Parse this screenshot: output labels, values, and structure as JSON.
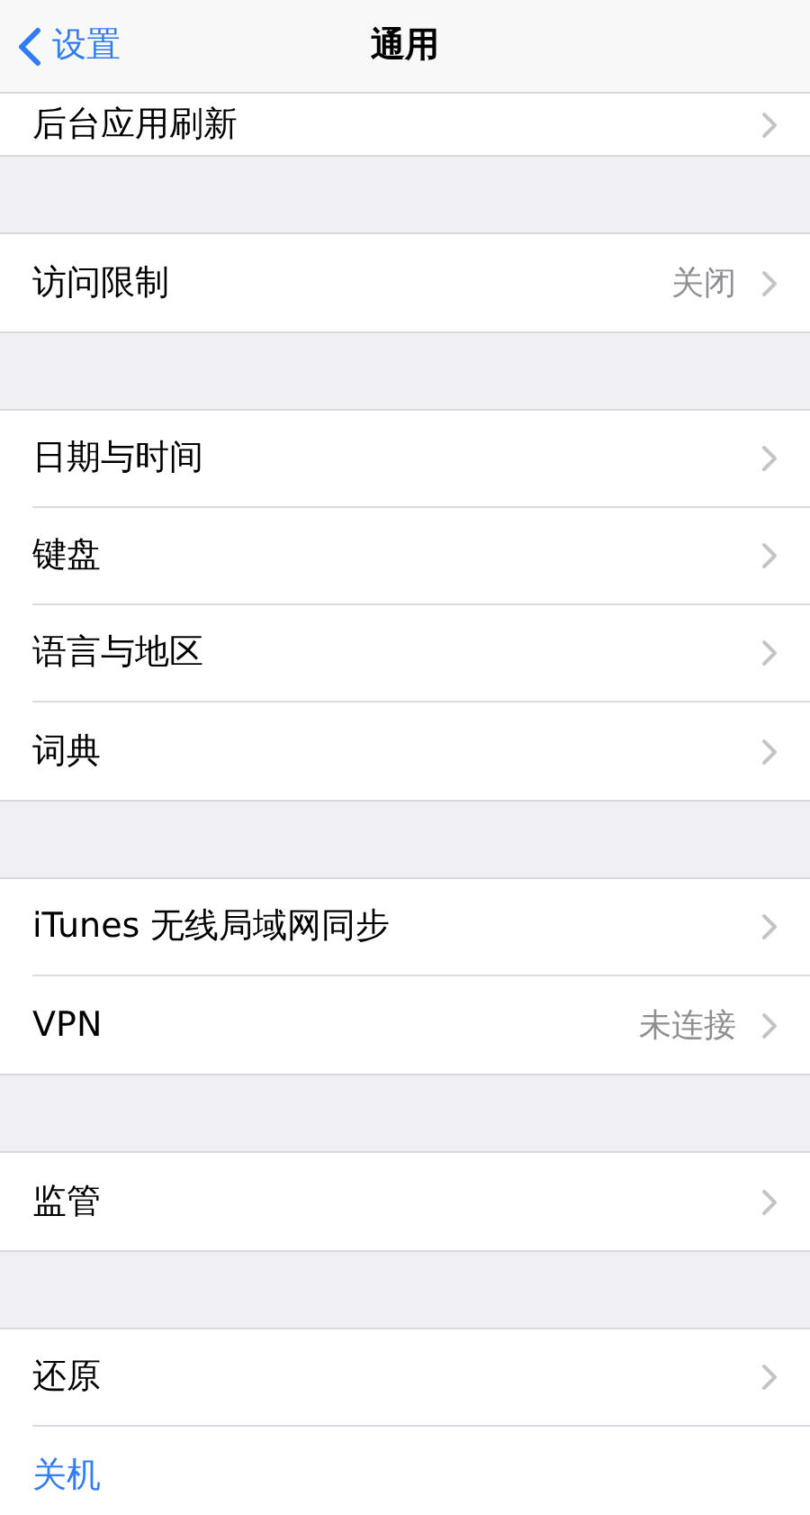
{
  "nav": {
    "back": "设置",
    "title": "通用"
  },
  "groups": [
    {
      "items": [
        {
          "kind": "link",
          "label": "后台应用刷新"
        }
      ]
    },
    {
      "items": [
        {
          "kind": "link",
          "label": "访问限制",
          "value": "关闭"
        }
      ]
    },
    {
      "items": [
        {
          "kind": "link",
          "label": "日期与时间"
        },
        {
          "kind": "link",
          "label": "键盘"
        },
        {
          "kind": "link",
          "label": "语言与地区"
        },
        {
          "kind": "link",
          "label": "词典"
        }
      ]
    },
    {
      "items": [
        {
          "kind": "link",
          "label": "iTunes 无线局域网同步"
        },
        {
          "kind": "link",
          "label": "VPN",
          "value": "未连接"
        }
      ]
    },
    {
      "items": [
        {
          "kind": "link",
          "label": "监管"
        }
      ]
    },
    {
      "items": [
        {
          "kind": "link",
          "label": "还原"
        },
        {
          "kind": "action",
          "label": "关机"
        }
      ]
    }
  ]
}
